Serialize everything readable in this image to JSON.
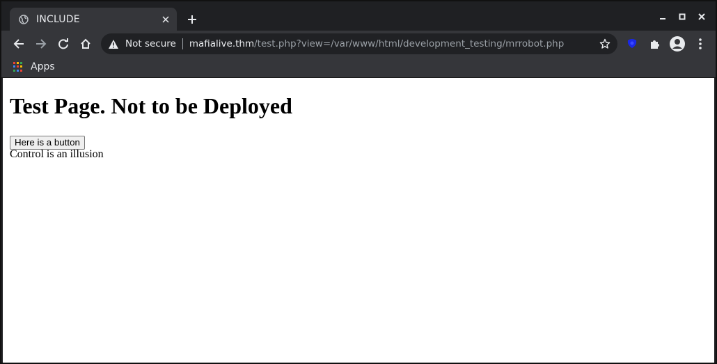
{
  "browser": {
    "tab": {
      "title": "INCLUDE",
      "favicon": "globe-icon"
    },
    "omnibox": {
      "security_label": "Not secure",
      "url_host": "mafialive.thm",
      "url_path": "/test.php?view=/var/www/html/development_testing/mrrobot.php"
    },
    "bookmarks": {
      "apps_label": "Apps"
    },
    "colors": {
      "frame": "#202124",
      "toolbar": "#35363a",
      "text": "#e8eaed",
      "muted": "#9aa0a6",
      "extension": "#1a28e6"
    }
  },
  "page": {
    "heading": "Test Page. Not to be Deployed",
    "button_label": "Here is a button",
    "text": "Control is an illusion"
  }
}
